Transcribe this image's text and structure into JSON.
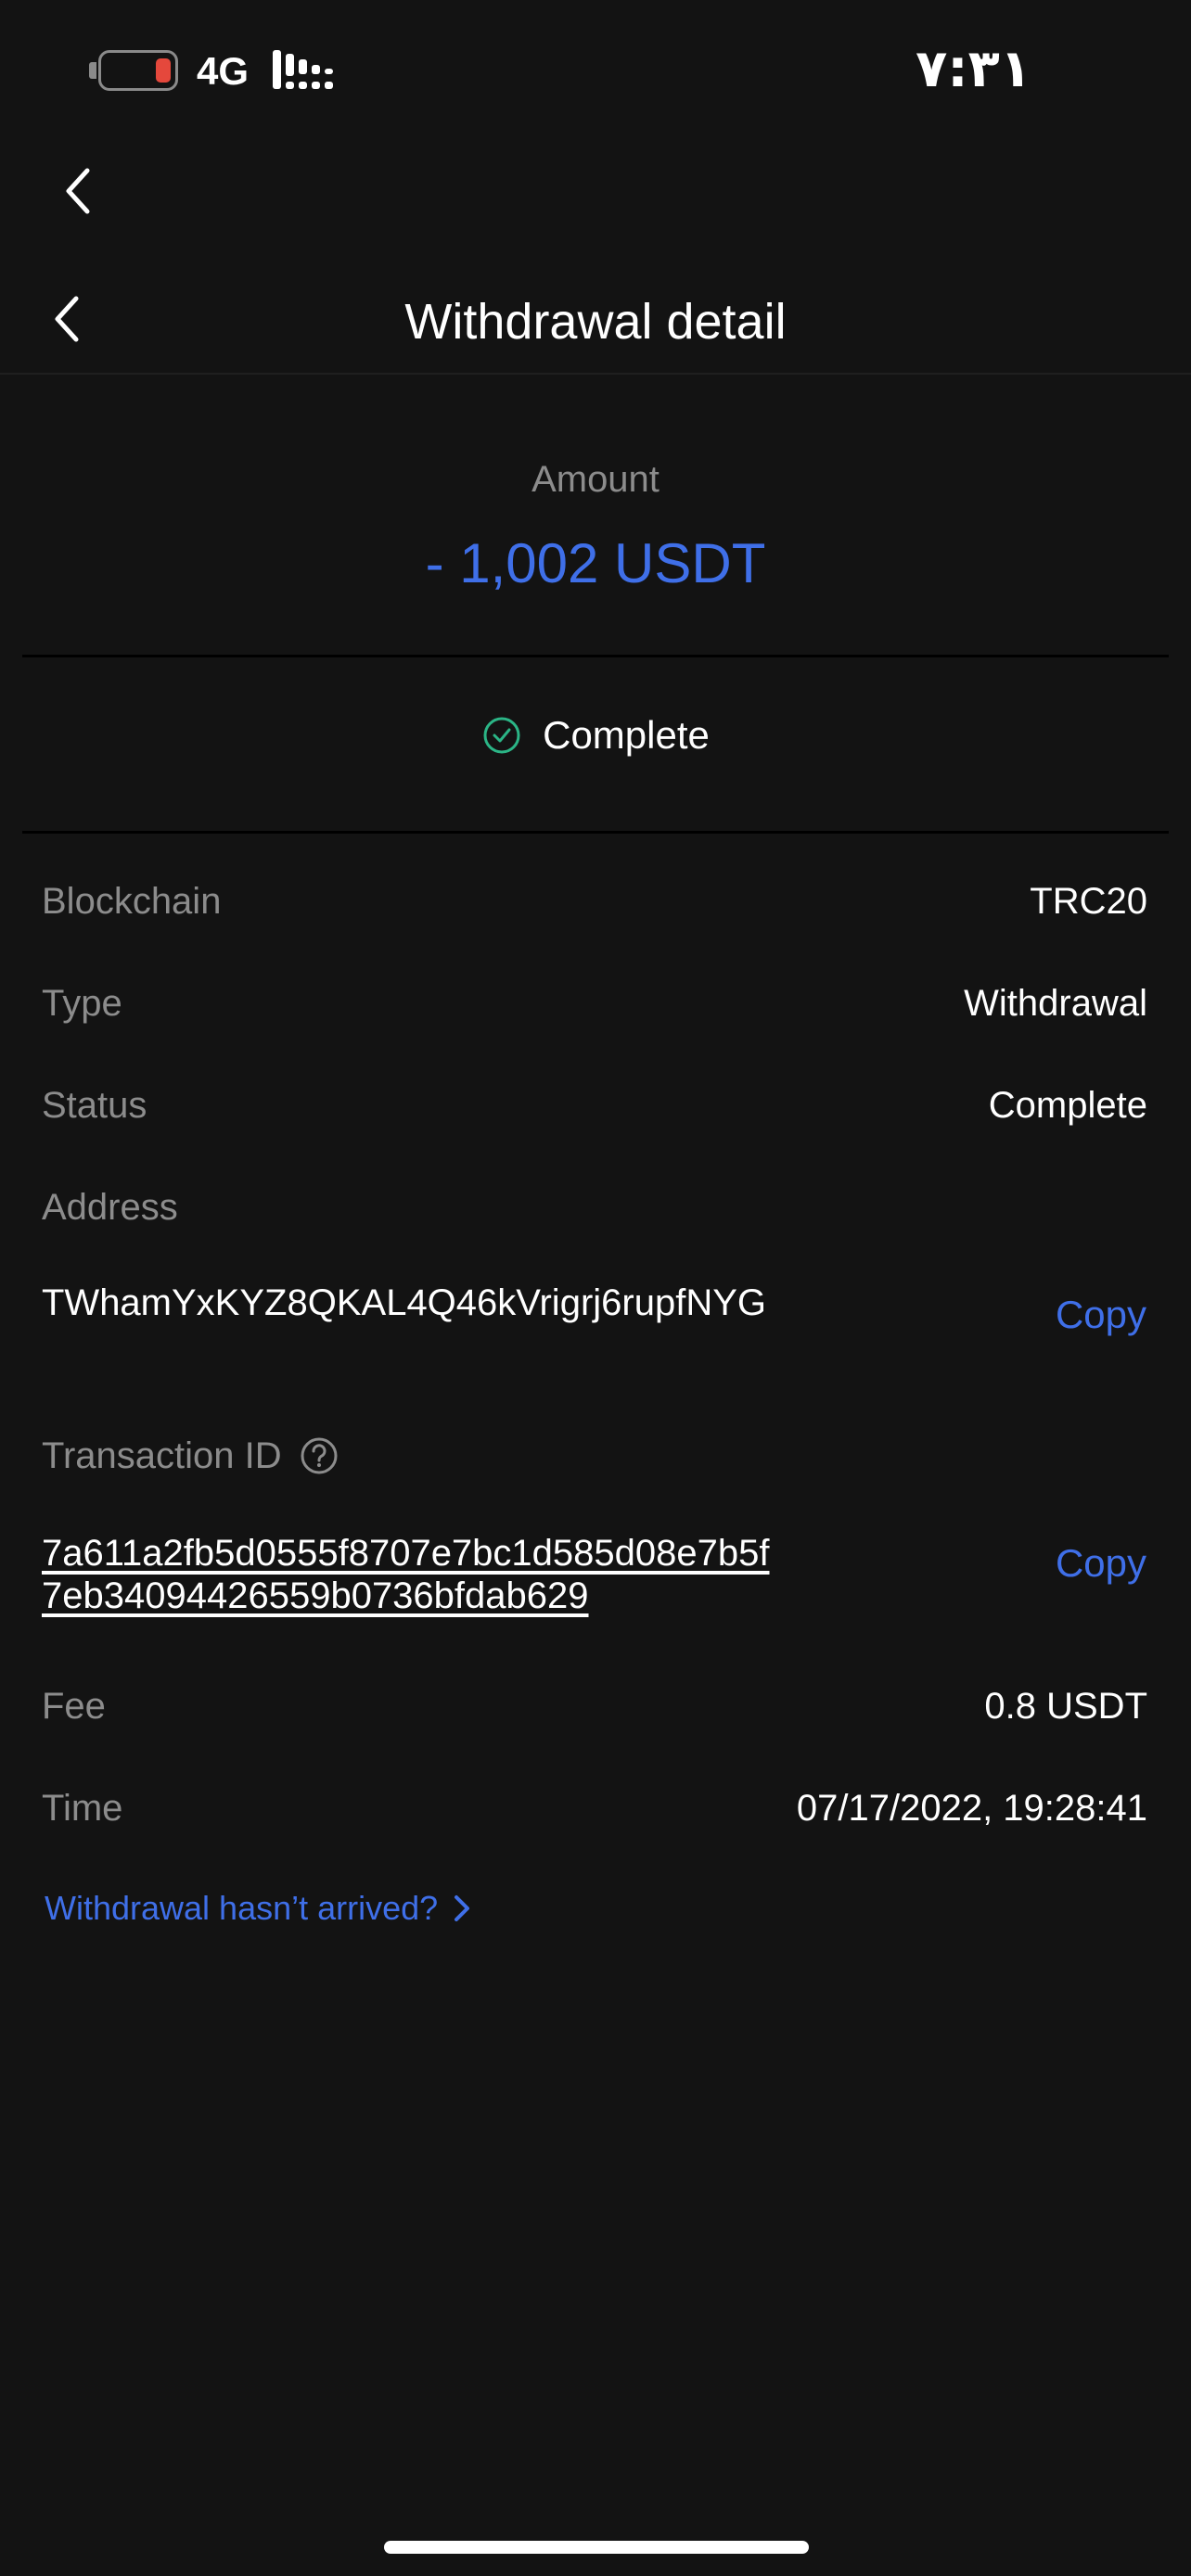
{
  "status_bar": {
    "network": "4G",
    "time": "۷:۳۱",
    "battery_level": 0.15
  },
  "header": {
    "title": "Withdrawal detail"
  },
  "amount": {
    "label": "Amount",
    "value": "- 1,002 USDT"
  },
  "status_banner": {
    "label": "Complete"
  },
  "details": {
    "blockchain": {
      "label": "Blockchain",
      "value": "TRC20"
    },
    "type": {
      "label": "Type",
      "value": "Withdrawal"
    },
    "status": {
      "label": "Status",
      "value": "Complete"
    },
    "address": {
      "label": "Address",
      "value": "TWhamYxKYZ8QKAL4Q46kVrigrj6rupfNYG",
      "copy_label": "Copy"
    },
    "transaction_id": {
      "label": "Transaction ID",
      "value": "7a611a2fb5d0555f8707e7bc1d585d08e7b5f7eb34094426559b0736bfdab629",
      "copy_label": "Copy"
    },
    "fee": {
      "label": "Fee",
      "value": "0.8 USDT"
    },
    "time": {
      "label": "Time",
      "value": "07/17/2022, 19:28:41"
    }
  },
  "help_link": {
    "label": "Withdrawal hasn’t arrived?"
  },
  "colors": {
    "background": "#131313",
    "accent": "#3f6fe8",
    "success": "#2bb586",
    "muted_text": "#8c8c8c"
  }
}
